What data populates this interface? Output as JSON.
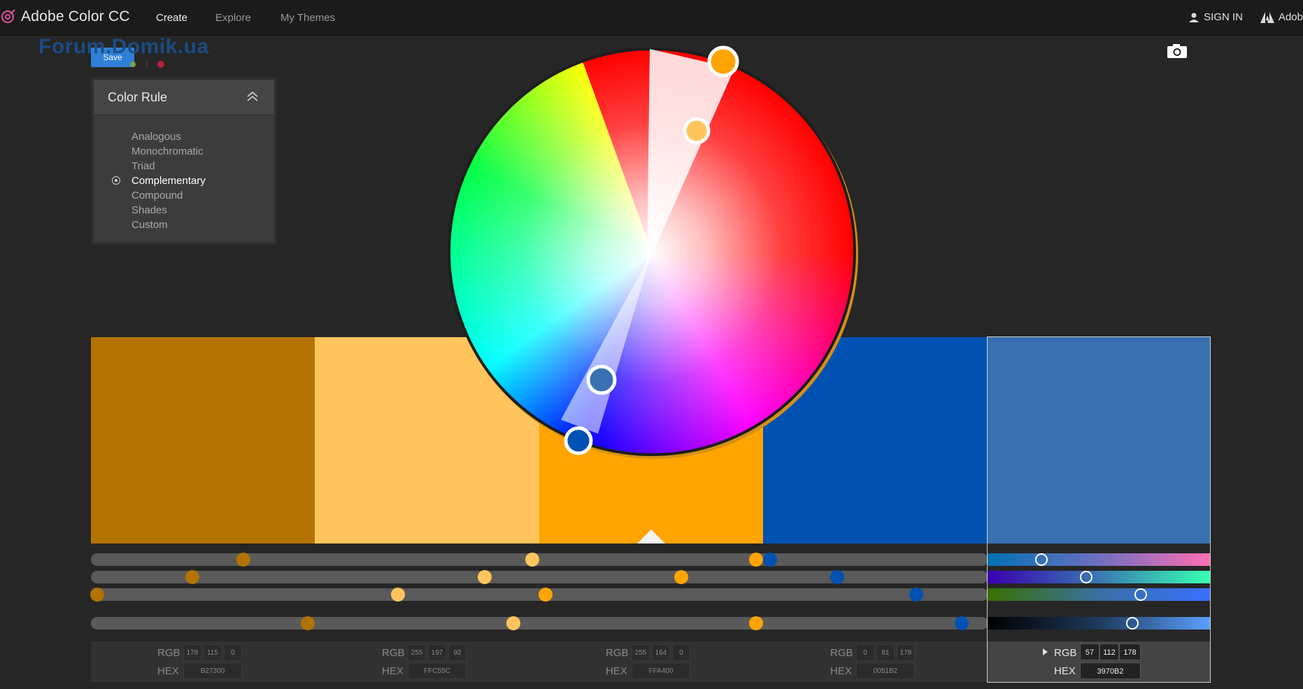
{
  "app": {
    "title": "Adobe Color CC",
    "nav": [
      {
        "label": "Create",
        "active": true
      },
      {
        "label": "Explore",
        "active": false
      },
      {
        "label": "My Themes",
        "active": false
      }
    ],
    "sign_in": "SIGN IN",
    "adobe_label": "Adob"
  },
  "watermark": "Forum.Domik.ua",
  "save_label": "Save",
  "color_rule": {
    "title": "Color Rule",
    "items": [
      {
        "label": "Analogous",
        "selected": false
      },
      {
        "label": "Monochromatic",
        "selected": false
      },
      {
        "label": "Triad",
        "selected": false
      },
      {
        "label": "Complementary",
        "selected": true
      },
      {
        "label": "Compound",
        "selected": false
      },
      {
        "label": "Shades",
        "selected": false
      },
      {
        "label": "Custom",
        "selected": false
      }
    ]
  },
  "colors": {
    "accent": "#2e7fd5",
    "background": "#262626"
  },
  "swatches": [
    {
      "hex": "B27300",
      "color": "#b27300",
      "rgb": [
        "178",
        "115",
        "0"
      ],
      "active": false
    },
    {
      "hex": "FFC55C",
      "color": "#ffc55c",
      "rgb": [
        "255",
        "197",
        "92"
      ],
      "active": false
    },
    {
      "hex": "FFA400",
      "color": "#ffa400",
      "rgb": [
        "255",
        "164",
        "0"
      ],
      "active": false
    },
    {
      "hex": "0051B2",
      "color": "#0051b2",
      "rgb": [
        "0",
        "81",
        "178"
      ],
      "active": false
    },
    {
      "hex": "3970B2",
      "color": "#3970b2",
      "rgb": [
        "57",
        "112",
        "178"
      ],
      "active": true
    }
  ],
  "value_labels": {
    "rgb": "RGB",
    "hex": "HEX"
  }
}
